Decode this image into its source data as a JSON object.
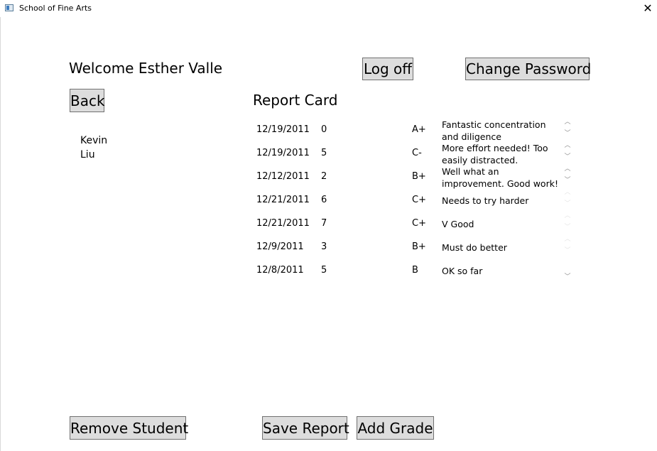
{
  "window": {
    "title": "School of Fine Arts",
    "close_glyph": "✕"
  },
  "header": {
    "welcome": "Welcome Esther Valle",
    "logoff_label": "Log off",
    "change_password_label": "Change Password"
  },
  "nav": {
    "back_label": "Back"
  },
  "report": {
    "title": "Report Card",
    "rows": [
      {
        "date": "12/19/2011",
        "num": "0",
        "grade": "A+",
        "comment": "Fantastic concentration and diligence"
      },
      {
        "date": "12/19/2011",
        "num": "5",
        "grade": "C-",
        "comment": "More effort needed! Too easily distracted."
      },
      {
        "date": "12/12/2011",
        "num": "2",
        "grade": "B+",
        "comment": "Well what an improvement. Good work!"
      },
      {
        "date": "12/21/2011",
        "num": "6",
        "grade": "C+",
        "comment": "Needs to try harder"
      },
      {
        "date": "12/21/2011",
        "num": "7",
        "grade": "C+",
        "comment": "V Good"
      },
      {
        "date": "12/9/2011",
        "num": "3",
        "grade": "B+",
        "comment": "Must do better"
      },
      {
        "date": "12/8/2011",
        "num": "5",
        "grade": "B",
        "comment": "OK so far"
      }
    ]
  },
  "students": [
    {
      "first": "Kevin",
      "last": "Liu"
    }
  ],
  "footer": {
    "remove_label": "Remove Student",
    "save_label": "Save Report",
    "add_label": "Add Grade"
  },
  "icons": {
    "app": "app-window-icon",
    "scroll_up": "chevron-up-icon",
    "scroll_down": "chevron-down-icon"
  }
}
